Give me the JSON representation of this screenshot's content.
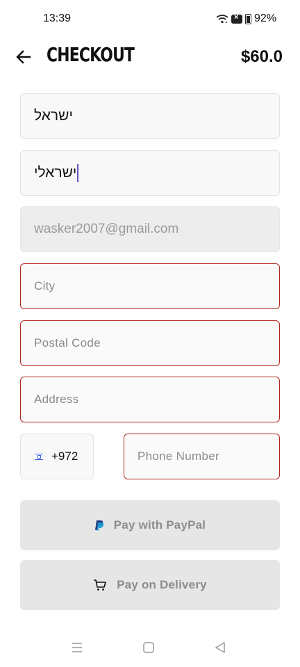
{
  "status_bar": {
    "time": "13:39",
    "battery": "92%",
    "icons": [
      "wifi-icon",
      "sim-error-icon",
      "battery-icon"
    ]
  },
  "header": {
    "title": "CHECKOUT",
    "total": "$60.0",
    "back_icon": "arrow-left-icon"
  },
  "form": {
    "first_name": {
      "value": "ישראל"
    },
    "last_name": {
      "value": "ישראלי"
    },
    "email": {
      "value": "wasker2007@gmail.com"
    },
    "city": {
      "placeholder": "City"
    },
    "postal_code": {
      "placeholder": "Postal Code"
    },
    "address": {
      "placeholder": "Address"
    },
    "phone_code": {
      "value": "+972",
      "flag": "israel-flag-icon"
    },
    "phone_number": {
      "placeholder": "Phone Number"
    }
  },
  "buttons": {
    "paypal": {
      "label": "Pay with PayPal",
      "icon": "paypal-icon"
    },
    "delivery": {
      "label": "Pay on Delivery",
      "icon": "cart-icon"
    }
  },
  "colors": {
    "error_border": "#b3261e",
    "cursor": "#6a4fc2",
    "button_bg": "#e6e6e6",
    "field_bg": "#f8f8f8"
  },
  "nav_bar": {
    "icons": [
      "menu-icon",
      "home-icon",
      "back-icon"
    ]
  }
}
